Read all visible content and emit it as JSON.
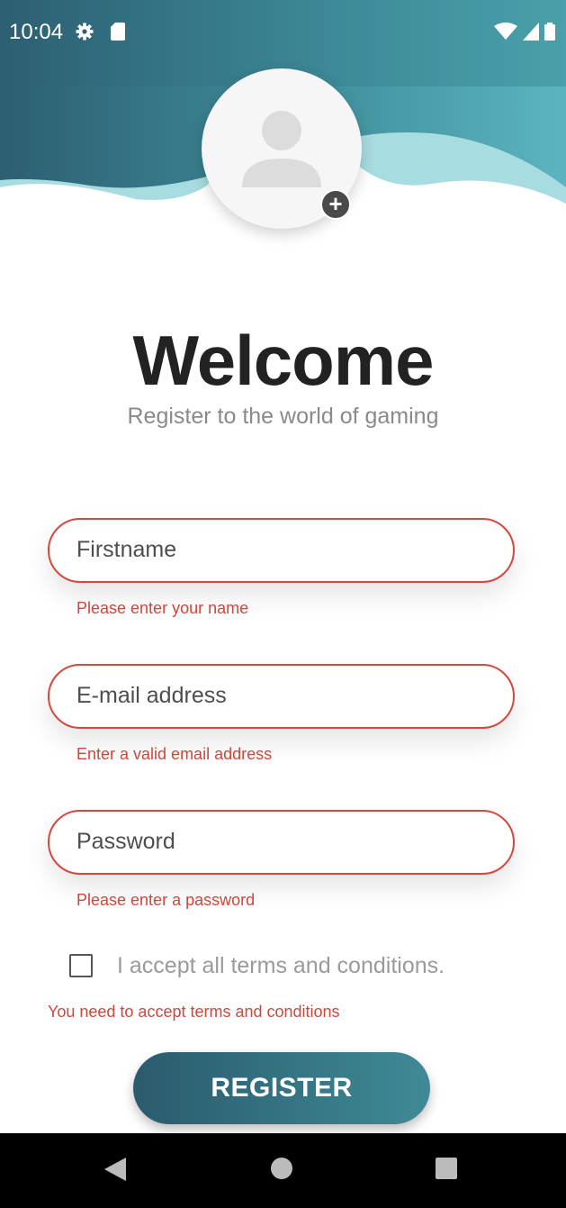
{
  "status": {
    "time": "10:04"
  },
  "colors": {
    "accent": "#2a5b6d",
    "error": "#d0463b",
    "header_light": "#a7dce0"
  },
  "header": {
    "title": "Welcome",
    "subtitle": "Register to the world of gaming"
  },
  "form": {
    "firstname": {
      "placeholder": "Firstname",
      "value": "",
      "error": "Please enter your name"
    },
    "email": {
      "placeholder": "E-mail address",
      "value": "",
      "error": "Enter a valid email address"
    },
    "password": {
      "placeholder": "Password",
      "value": "",
      "error": "Please enter a password"
    },
    "terms": {
      "label": "I accept all terms and conditions.",
      "checked": false,
      "error": "You need to accept terms and conditions"
    },
    "register_label": "REGISTER"
  },
  "icons": {
    "status": [
      "gear-icon",
      "sd-card-icon",
      "wifi-icon",
      "signal-icon",
      "battery-icon"
    ],
    "avatar": "person-icon",
    "add_photo": "plus-icon",
    "nav": [
      "back-icon",
      "home-icon",
      "recents-icon"
    ]
  }
}
